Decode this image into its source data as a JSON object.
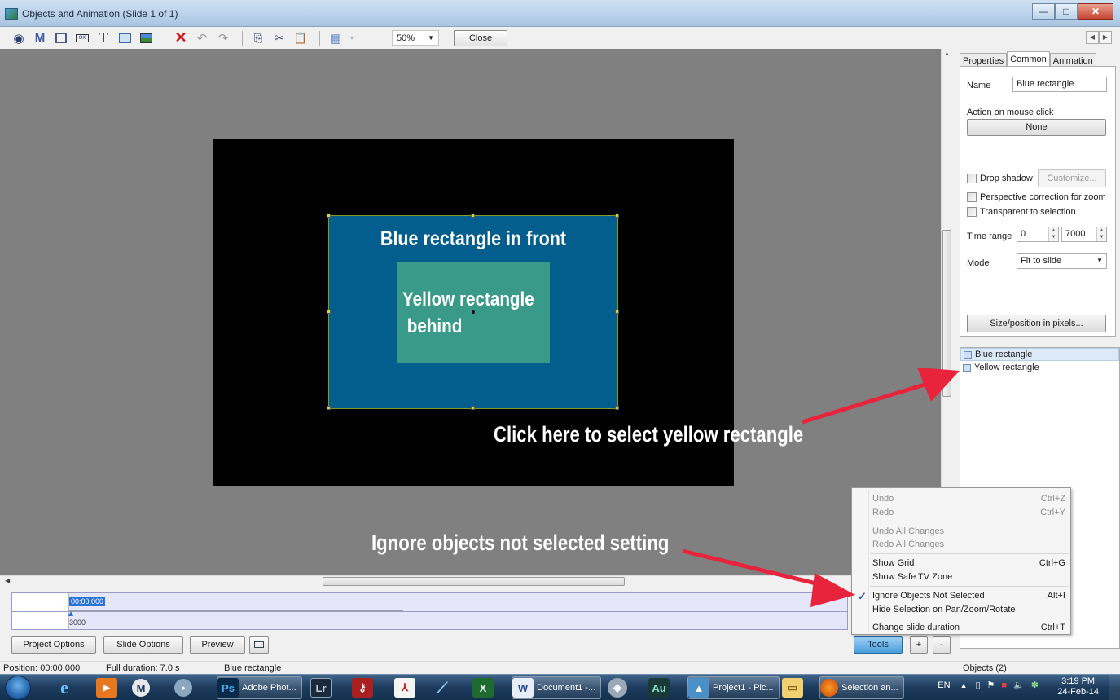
{
  "window": {
    "title": "Objects and Animation  (Slide 1 of 1)",
    "minimize": "—",
    "maximize": "□",
    "close": "✕"
  },
  "toolbar": {
    "icons": [
      "camera-icon",
      "m-icon",
      "frame-icon",
      "button-icon",
      "text-icon",
      "rectangle-icon",
      "image-icon",
      "delete-icon",
      "undo-icon",
      "redo-icon",
      "copy-icon",
      "cut-icon",
      "paste-icon",
      "grid-icon"
    ],
    "zoom": "50%",
    "close_label": "Close"
  },
  "slide": {
    "blue_text": "Blue rectangle in front",
    "yellow_text": "Yellow rectangle\n behind"
  },
  "annotations": {
    "select_hint": "Click here to select yellow rectangle",
    "ignore_hint": "Ignore objects not selected setting",
    "arrow_color": "#e8233c"
  },
  "panel": {
    "tabs": [
      "Properties",
      "Common",
      "Animation"
    ],
    "active_tab": "Common",
    "name_label": "Name",
    "name_value": "Blue rectangle",
    "action_label": "Action on mouse click",
    "action_value": "None",
    "drop_shadow": "Drop shadow",
    "customize": "Customize...",
    "perspective": "Perspective correction for zoom",
    "transparent": "Transparent to selection",
    "time_range_label": "Time range",
    "time_from": "0",
    "time_to": "7000",
    "mode_label": "Mode",
    "mode_value": "Fit to slide",
    "size_button": "Size/position in pixels...",
    "objects": [
      "Blue rectangle",
      "Yellow rectangle"
    ]
  },
  "timeline": {
    "position": "00:00.000",
    "duration_marker": "3000"
  },
  "bottom": {
    "project_options": "Project Options",
    "slide_options": "Slide Options",
    "preview": "Preview",
    "tools": "Tools",
    "plus": "+",
    "minus": "-"
  },
  "menu": {
    "undo": "Undo",
    "undo_key": "Ctrl+Z",
    "redo": "Redo",
    "redo_key": "Ctrl+Y",
    "undo_all": "Undo All Changes",
    "redo_all": "Redo All Changes",
    "show_grid": "Show Grid",
    "show_grid_key": "Ctrl+G",
    "safe_tv": "Show Safe TV Zone",
    "ignore": "Ignore Objects Not Selected",
    "ignore_key": "Alt+I",
    "hide_sel": "Hide Selection on Pan/Zoom/Rotate",
    "change_dur": "Change slide duration",
    "change_dur_key": "Ctrl+T",
    "check": "✓"
  },
  "status": {
    "position": "Position: 00:00.000",
    "full_duration": "Full duration: 7.0 s",
    "selected": "Blue rectangle",
    "objects": "Objects (2)"
  },
  "taskbar": {
    "items": [
      {
        "icon": "ie-icon",
        "label": ""
      },
      {
        "icon": "media-player-icon",
        "label": ""
      },
      {
        "icon": "m-app-icon",
        "label": ""
      },
      {
        "icon": "cat-icon",
        "label": ""
      },
      {
        "icon": "photoshop-icon",
        "glyph": "Ps",
        "label": "Adobe Phot..."
      },
      {
        "icon": "lightroom-icon",
        "glyph": "Lr",
        "label": ""
      },
      {
        "icon": "key-app-icon",
        "label": ""
      },
      {
        "icon": "acrobat-icon",
        "label": ""
      },
      {
        "icon": "feather-icon",
        "label": ""
      },
      {
        "icon": "excel-icon",
        "label": ""
      },
      {
        "icon": "word-icon",
        "label": "Document1 -..."
      },
      {
        "icon": "app-icon",
        "label": ""
      },
      {
        "icon": "audition-icon",
        "glyph": "Au",
        "label": ""
      },
      {
        "icon": "pictures-icon",
        "label": "Project1 - Pic..."
      },
      {
        "icon": "folder-icon",
        "label": ""
      },
      {
        "icon": "firefox-icon",
        "label": "Selection an..."
      }
    ],
    "lang": "EN",
    "time": "3:19 PM",
    "date": "24-Feb-14"
  }
}
